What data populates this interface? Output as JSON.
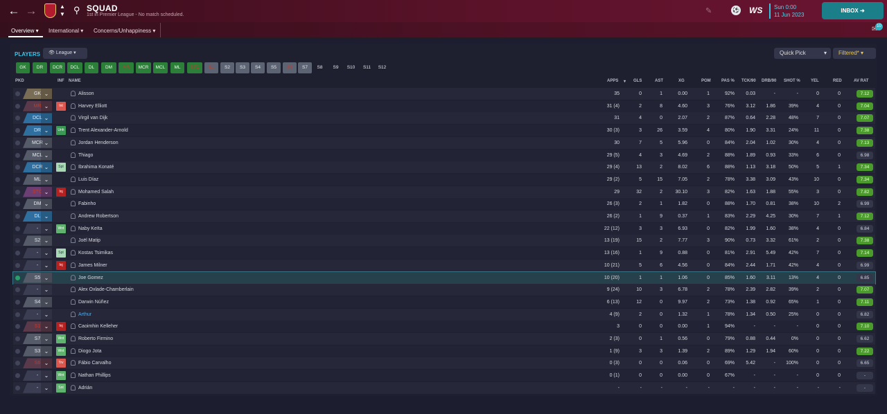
{
  "nav": {
    "back": "←",
    "forward": "→"
  },
  "header": {
    "title": "SQUAD",
    "subtitle": "1st in Premier League - No match scheduled.",
    "day": "Sun 0:00",
    "date": "11 Jun 2023",
    "logo": "WS",
    "inbox": "INBOX",
    "notifications": "10"
  },
  "tabs": [
    "Overview",
    "International",
    "Concerns/Unhappiness"
  ],
  "toolbar": {
    "section": "PLAYERS",
    "view": "League",
    "quick_pick": "Quick Pick",
    "filter": "Filtered*"
  },
  "chips": [
    {
      "label": "GK",
      "style": "green"
    },
    {
      "label": "DR",
      "style": "green"
    },
    {
      "label": "DCR",
      "style": "green"
    },
    {
      "label": "DCL",
      "style": "green"
    },
    {
      "label": "DL",
      "style": "green"
    },
    {
      "label": "DM",
      "style": "green"
    },
    {
      "label": "MR",
      "style": "green-red"
    },
    {
      "label": "MCR",
      "style": "green"
    },
    {
      "label": "MCL",
      "style": "green"
    },
    {
      "label": "ML",
      "style": "green"
    },
    {
      "label": "STC",
      "style": "green-red"
    },
    {
      "label": "S1",
      "style": "grey-red"
    },
    {
      "label": "S2",
      "style": "grey"
    },
    {
      "label": "S3",
      "style": "grey"
    },
    {
      "label": "S4",
      "style": "grey"
    },
    {
      "label": "S5",
      "style": "grey"
    },
    {
      "label": "S6",
      "style": "grey-red"
    },
    {
      "label": "S7",
      "style": "grey"
    },
    {
      "label": "S8",
      "style": "dark"
    },
    {
      "label": "S9",
      "style": "dark"
    },
    {
      "label": "S10",
      "style": "dark"
    },
    {
      "label": "S11",
      "style": "dark"
    },
    {
      "label": "S12",
      "style": "dark"
    }
  ],
  "columns": {
    "pkd": "PKD",
    "inf": "INF",
    "name": "NAME",
    "apps": "APPS",
    "gls": "GLS",
    "ast": "AST",
    "xg": "XG",
    "pom": "POM",
    "pas": "PAS %",
    "tck": "TCK/90",
    "drb": "DRB/90",
    "shot": "SHOT %",
    "yel": "YEL",
    "red": "RED",
    "avrat": "AV RAT"
  },
  "rows": [
    {
      "pos": "GK",
      "pcol": "#7a6d55",
      "badge": "",
      "bcol": "",
      "name": "Alisson",
      "apps": "35",
      "gls": "0",
      "ast": "1",
      "xg": "0.00",
      "pom": "1",
      "pas": "92%",
      "tck": "0.03",
      "drb": "-",
      "shot": "-",
      "yel": "0",
      "red": "0",
      "av": "7.12",
      "avcol": "#4a9a2c"
    },
    {
      "pos": "MR",
      "pcol": "#5a3a4a",
      "badge": "Int",
      "bcol": "#d9574f",
      "name": "Harvey Elliott",
      "apps": "31 (4)",
      "gls": "2",
      "ast": "8",
      "xg": "4.60",
      "pom": "3",
      "pas": "76%",
      "tck": "3.12",
      "drb": "1.86",
      "shot": "39%",
      "yel": "4",
      "red": "0",
      "av": "7.04",
      "avcol": "#4a9a2c"
    },
    {
      "pos": "DCL",
      "pcol": "#2f6fa0",
      "badge": "",
      "bcol": "",
      "name": "Virgil van Dijk",
      "apps": "31",
      "gls": "4",
      "ast": "0",
      "xg": "2.07",
      "pom": "2",
      "pas": "87%",
      "tck": "0.64",
      "drb": "2.28",
      "shot": "48%",
      "yel": "7",
      "red": "0",
      "av": "7.07",
      "avcol": "#4a9a2c"
    },
    {
      "pos": "DR",
      "pcol": "#2f6fa0",
      "badge": "Unh",
      "bcol": "#3a9a55",
      "name": "Trent Alexander-Arnold",
      "apps": "30 (3)",
      "gls": "3",
      "ast": "26",
      "xg": "3.59",
      "pom": "4",
      "pas": "80%",
      "tck": "1.90",
      "drb": "3.31",
      "shot": "24%",
      "yel": "11",
      "red": "0",
      "av": "7.38",
      "avcol": "#4a9a2c"
    },
    {
      "pos": "MCR",
      "pcol": "#555b69",
      "badge": "",
      "bcol": "",
      "name": "Jordan Henderson",
      "apps": "30",
      "gls": "7",
      "ast": "5",
      "xg": "5.96",
      "pom": "0",
      "pas": "84%",
      "tck": "2.04",
      "drb": "1.02",
      "shot": "30%",
      "yel": "4",
      "red": "0",
      "av": "7.13",
      "avcol": "#4a9a2c"
    },
    {
      "pos": "MCL",
      "pcol": "#555b69",
      "badge": "",
      "bcol": "",
      "name": "Thiago",
      "apps": "29 (5)",
      "gls": "4",
      "ast": "3",
      "xg": "4.69",
      "pom": "2",
      "pas": "88%",
      "tck": "1.89",
      "drb": "0.93",
      "shot": "33%",
      "yel": "6",
      "red": "0",
      "av": "6.98",
      "avcol": ""
    },
    {
      "pos": "DCR",
      "pcol": "#2f6fa0",
      "badge": "Spt",
      "bcol": "#a9d8b4",
      "name": "Ibrahima Konaté",
      "apps": "29 (4)",
      "gls": "13",
      "ast": "2",
      "xg": "8.02",
      "pom": "6",
      "pas": "88%",
      "tck": "1.13",
      "drb": "3.18",
      "shot": "50%",
      "yel": "5",
      "red": "1",
      "av": "7.34",
      "avcol": "#4a9a2c"
    },
    {
      "pos": "ML",
      "pcol": "#555b69",
      "badge": "",
      "bcol": "",
      "name": "Luis Díaz",
      "apps": "29 (2)",
      "gls": "5",
      "ast": "15",
      "xg": "7.05",
      "pom": "2",
      "pas": "78%",
      "tck": "3.38",
      "drb": "3.09",
      "shot": "43%",
      "yel": "10",
      "red": "0",
      "av": "7.34",
      "avcol": "#4a9a2c"
    },
    {
      "pos": "STC",
      "pcol": "#6b3f73",
      "badge": "Inj",
      "bcol": "#b42121",
      "name": "Mohamed Salah",
      "apps": "29",
      "gls": "32",
      "ast": "2",
      "xg": "30.10",
      "pom": "3",
      "pas": "82%",
      "tck": "1.63",
      "drb": "1.88",
      "shot": "55%",
      "yel": "3",
      "red": "0",
      "av": "7.82",
      "avcol": "#4a9a2c"
    },
    {
      "pos": "DM",
      "pcol": "#555b69",
      "badge": "",
      "bcol": "",
      "name": "Fabinho",
      "apps": "26 (3)",
      "gls": "2",
      "ast": "1",
      "xg": "1.82",
      "pom": "0",
      "pas": "88%",
      "tck": "1.70",
      "drb": "0.81",
      "shot": "38%",
      "yel": "10",
      "red": "2",
      "av": "6.99",
      "avcol": ""
    },
    {
      "pos": "DL",
      "pcol": "#2f6fa0",
      "badge": "",
      "bcol": "",
      "name": "Andrew Robertson",
      "apps": "26 (2)",
      "gls": "1",
      "ast": "9",
      "xg": "0.37",
      "pom": "1",
      "pas": "83%",
      "tck": "2.29",
      "drb": "4.25",
      "shot": "30%",
      "yel": "7",
      "red": "1",
      "av": "7.12",
      "avcol": "#4a9a2c"
    },
    {
      "pos": "-",
      "pcol": "#3b3e52",
      "badge": "Wnt",
      "bcol": "#5fb36e",
      "name": "Naby Keïta",
      "apps": "22 (12)",
      "gls": "3",
      "ast": "3",
      "xg": "6.93",
      "pom": "0",
      "pas": "82%",
      "tck": "1.99",
      "drb": "1.60",
      "shot": "38%",
      "yel": "4",
      "red": "0",
      "av": "6.84",
      "avcol": ""
    },
    {
      "pos": "S2",
      "pcol": "#555b69",
      "badge": "",
      "bcol": "",
      "name": "Joël Matip",
      "apps": "13 (19)",
      "gls": "15",
      "ast": "2",
      "xg": "7.77",
      "pom": "3",
      "pas": "90%",
      "tck": "0.73",
      "drb": "3.32",
      "shot": "61%",
      "yel": "2",
      "red": "0",
      "av": "7.38",
      "avcol": "#4a9a2c"
    },
    {
      "pos": "-",
      "pcol": "#3b3e52",
      "badge": "Spt",
      "bcol": "#a9d8b4",
      "name": "Kostas Tsimikas",
      "apps": "13 (16)",
      "gls": "1",
      "ast": "9",
      "xg": "0.88",
      "pom": "0",
      "pas": "81%",
      "tck": "2.91",
      "drb": "5.49",
      "shot": "42%",
      "yel": "7",
      "red": "0",
      "av": "7.14",
      "avcol": "#4a9a2c"
    },
    {
      "pos": "-",
      "pcol": "#3b3e52",
      "badge": "Inj",
      "bcol": "#b42121",
      "name": "James Milner",
      "apps": "10 (21)",
      "gls": "5",
      "ast": "6",
      "xg": "4.56",
      "pom": "0",
      "pas": "84%",
      "tck": "2.44",
      "drb": "1.71",
      "shot": "42%",
      "yel": "4",
      "red": "0",
      "av": "6.99",
      "avcol": ""
    },
    {
      "pos": "S5",
      "pcol": "#555b69",
      "badge": "",
      "bcol": "",
      "name": "Joe Gomez",
      "apps": "10 (20)",
      "gls": "1",
      "ast": "1",
      "xg": "1.06",
      "pom": "0",
      "pas": "85%",
      "tck": "1.60",
      "drb": "3.11",
      "shot": "13%",
      "yel": "4",
      "red": "0",
      "av": "6.85",
      "avcol": "",
      "sel": "y"
    },
    {
      "pos": "-",
      "pcol": "#3b3e52",
      "badge": "",
      "bcol": "",
      "name": "Alex Oxlade-Chamberlain",
      "apps": "9 (24)",
      "gls": "10",
      "ast": "3",
      "xg": "6.78",
      "pom": "2",
      "pas": "78%",
      "tck": "2.39",
      "drb": "2.82",
      "shot": "39%",
      "yel": "2",
      "red": "0",
      "av": "7.07",
      "avcol": "#4a9a2c"
    },
    {
      "pos": "S4",
      "pcol": "#555b69",
      "badge": "",
      "bcol": "",
      "name": "Darwin Núñez",
      "apps": "6 (13)",
      "gls": "12",
      "ast": "0",
      "xg": "9.97",
      "pom": "2",
      "pas": "73%",
      "tck": "1.38",
      "drb": "0.92",
      "shot": "65%",
      "yel": "1",
      "red": "0",
      "av": "7.11",
      "avcol": "#4a9a2c"
    },
    {
      "pos": "-",
      "pcol": "#3b3e52",
      "badge": "",
      "bcol": "",
      "name": "Arthur",
      "apps": "4 (9)",
      "gls": "2",
      "ast": "0",
      "xg": "1.32",
      "pom": "1",
      "pas": "78%",
      "tck": "1.34",
      "drb": "0.50",
      "shot": "25%",
      "yel": "0",
      "red": "0",
      "av": "6.82",
      "avcol": "",
      "nblue": "y"
    },
    {
      "pos": "S1",
      "pcol": "#5a3a4a",
      "badge": "Inj",
      "bcol": "#b42121",
      "name": "Caoimhin Kelleher",
      "apps": "3",
      "gls": "0",
      "ast": "0",
      "xg": "0.00",
      "pom": "1",
      "pas": "94%",
      "tck": "-",
      "drb": "-",
      "shot": "-",
      "yel": "0",
      "red": "0",
      "av": "7.10",
      "avcol": "#4a9a2c"
    },
    {
      "pos": "S7",
      "pcol": "#555b69",
      "badge": "Wnt",
      "bcol": "#5fb36e",
      "name": "Roberto Firmino",
      "apps": "2 (3)",
      "gls": "0",
      "ast": "1",
      "xg": "0.56",
      "pom": "0",
      "pas": "79%",
      "tck": "0.88",
      "drb": "0.44",
      "shot": "0%",
      "yel": "0",
      "red": "0",
      "av": "6.62",
      "avcol": ""
    },
    {
      "pos": "S3",
      "pcol": "#555b69",
      "badge": "Wnt",
      "bcol": "#5fb36e",
      "name": "Diogo Jota",
      "apps": "1 (9)",
      "gls": "3",
      "ast": "3",
      "xg": "1.39",
      "pom": "2",
      "pas": "89%",
      "tck": "1.29",
      "drb": "1.94",
      "shot": "60%",
      "yel": "0",
      "red": "0",
      "av": "7.22",
      "avcol": "#4a9a2c"
    },
    {
      "pos": "S6",
      "pcol": "#5a3a4a",
      "badge": "Trv",
      "bcol": "#d9574f",
      "name": "Fábio Carvalho",
      "apps": "0 (3)",
      "gls": "0",
      "ast": "0",
      "xg": "0.06",
      "pom": "0",
      "pas": "69%",
      "tck": "5.42",
      "drb": "-",
      "shot": "100%",
      "yel": "0",
      "red": "0",
      "av": "6.65",
      "avcol": ""
    },
    {
      "pos": "-",
      "pcol": "#3b3e52",
      "badge": "Wnt",
      "bcol": "#5fb36e",
      "name": "Nathan Phillips",
      "apps": "0 (1)",
      "gls": "0",
      "ast": "0",
      "xg": "0.00",
      "pom": "0",
      "pas": "67%",
      "tck": "-",
      "drb": "-",
      "shot": "-",
      "yel": "0",
      "red": "0",
      "av": "-",
      "avcol": ""
    },
    {
      "pos": "-",
      "pcol": "#3b3e52",
      "badge": "Snt",
      "bcol": "#5fb36e",
      "name": "Adrián",
      "apps": "-",
      "gls": "-",
      "ast": "-",
      "xg": "-",
      "pom": "-",
      "pas": "-",
      "tck": "-",
      "drb": "-",
      "shot": "-",
      "yel": "-",
      "red": "-",
      "av": "-",
      "avcol": ""
    }
  ]
}
